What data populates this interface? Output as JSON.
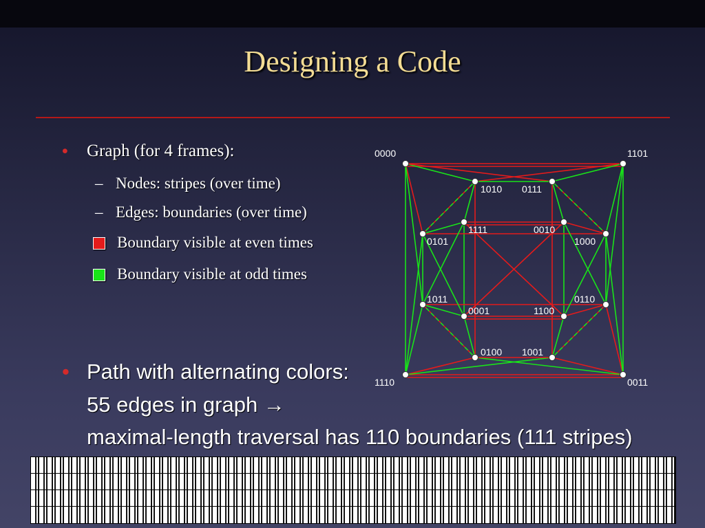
{
  "slide": {
    "title": "Designing a Code"
  },
  "bullets": {
    "graph_label": "Graph (for 4 frames):",
    "nodes_label": "Nodes: stripes (over time)",
    "edges_label": "Edges: boundaries (over time)",
    "even_label": "Boundary visible at even times",
    "odd_label": "Boundary visible at odd times",
    "dash": "–",
    "dot": "•",
    "path_line1": "Path with alternating colors:",
    "path_line2": "55 edges in graph →",
    "path_line3": "maximal-length traversal has 110 boundaries (111 stripes)"
  },
  "colors": {
    "even": "#e41b1b",
    "odd": "#19e419",
    "title": "#f3dc94",
    "rule": "#b51818"
  },
  "graph": {
    "nodes": [
      {
        "id": "0000"
      },
      {
        "id": "1101"
      },
      {
        "id": "1010"
      },
      {
        "id": "0111"
      },
      {
        "id": "1111"
      },
      {
        "id": "0010"
      },
      {
        "id": "0101"
      },
      {
        "id": "1000"
      },
      {
        "id": "1011"
      },
      {
        "id": "0110"
      },
      {
        "id": "0001"
      },
      {
        "id": "1100"
      },
      {
        "id": "0100"
      },
      {
        "id": "1001"
      },
      {
        "id": "1110"
      },
      {
        "id": "0011"
      }
    ]
  }
}
